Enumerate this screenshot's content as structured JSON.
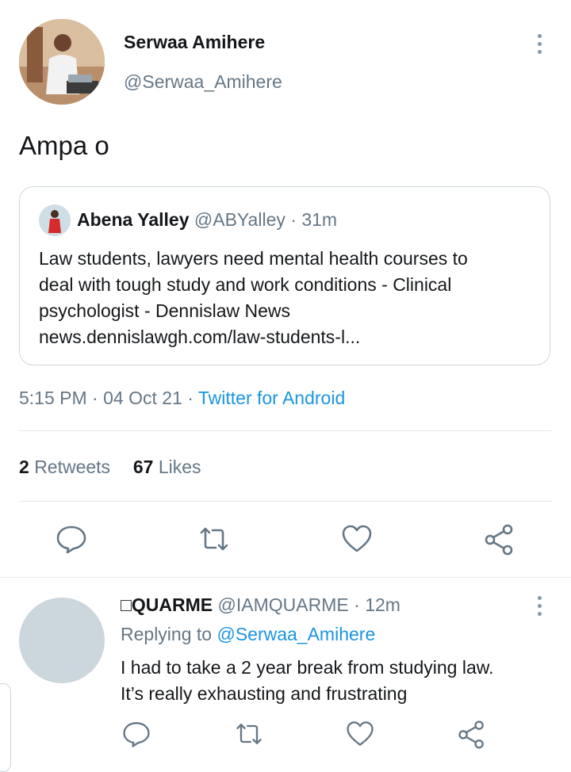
{
  "tweet": {
    "author_name": "Serwaa Amihere",
    "author_handle": "@Serwaa_Amihere",
    "text": "Ampa o",
    "quoted": {
      "name": "Abena Yalley",
      "handle": "@ABYalley",
      "separator": "·",
      "time": "31m",
      "text_lines": [
        "Law students, lawyers need mental health courses to",
        "deal with tough study and work conditions - Clinical",
        "psychologist - Dennislaw News",
        "news.dennislawgh.com/law-students-l..."
      ]
    },
    "time": "5:15 PM",
    "date": "04 Oct 21",
    "source": "Twitter for Android",
    "retweets_count": "2",
    "retweets_label": "Retweets",
    "likes_count": "67",
    "likes_label": "Likes"
  },
  "reply": {
    "name": "QUARME",
    "handle": "@IAMQUARME",
    "separator": "·",
    "time": "12m",
    "replying_to_label": "Replying to",
    "replying_to_handle": "@Serwaa_Amihere",
    "text_lines": [
      "I had to take a 2 year break from studying law.",
      "It’s really exhausting and frustrating"
    ]
  },
  "icons": {
    "reply": "comment-bubble-icon",
    "retweet": "retweet-arrows-icon",
    "like": "heart-icon",
    "share": "share-nodes-icon",
    "menu": "vertical-dots-icon"
  },
  "colors": {
    "link": "#1b95e0",
    "muted": "#657786",
    "icon": "#657786"
  }
}
